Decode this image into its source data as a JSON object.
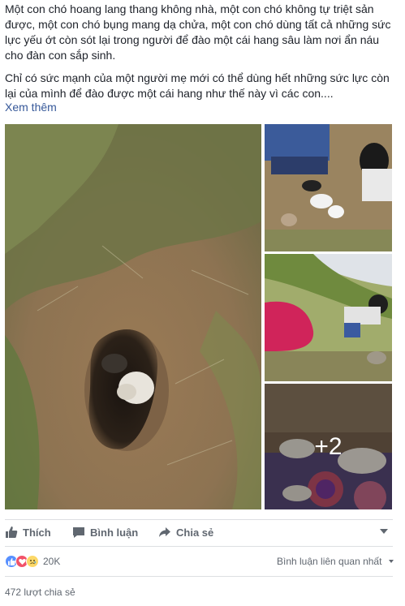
{
  "post": {
    "paragraph1": "Một con chó hoang lang thang không nhà, một con chó không tự triệt sản được, một con chó bụng mang dạ chửa, một con chó dùng tất cả những sức lực yếu ớt còn sót lại trong người để đào một cái hang sâu làm nơi ẩn náu cho đàn con sắp sinh.",
    "paragraph2": "Chỉ có sức mạnh của một người mẹ mới có thể dùng hết những sức lực còn lại của mình để đào được một cái hang như thế này vì các con....",
    "see_more": "Xem thêm"
  },
  "photos": {
    "more_count": "+2"
  },
  "actions": {
    "like": "Thích",
    "comment": "Bình luận",
    "share": "Chia sẻ"
  },
  "reactions": {
    "count": "20K",
    "icons": [
      "like-icon",
      "love-icon",
      "sad-icon"
    ]
  },
  "comments_filter": "Bình luận liên quan nhất",
  "shares": "472 lượt chia sẻ",
  "colors": {
    "link": "#365899",
    "meta": "#606770",
    "like_blue": "#5890ff",
    "love_red": "#f25268",
    "sad_yellow": "#fcd868"
  }
}
